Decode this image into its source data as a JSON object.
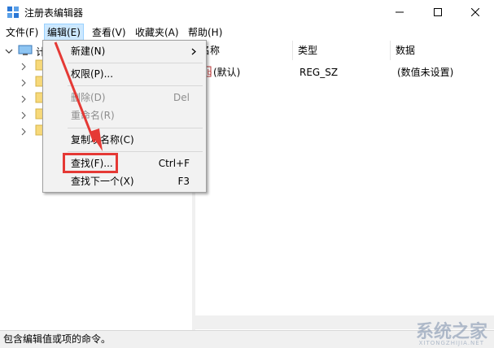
{
  "window": {
    "title": "注册表编辑器",
    "controls": {
      "minimize": "—",
      "maximize": "☐",
      "close": "✕"
    }
  },
  "menubar": {
    "items": [
      {
        "label": "文件(F)"
      },
      {
        "label": "编辑(E)",
        "active": true
      },
      {
        "label": "查看(V)"
      },
      {
        "label": "收藏夹(A)"
      },
      {
        "label": "帮助(H)"
      }
    ]
  },
  "tree": {
    "root_label": "计",
    "child_rows": 6
  },
  "list": {
    "columns": [
      "名称",
      "类型",
      "数据"
    ],
    "rows": [
      {
        "name": "(默认)",
        "type": "REG_SZ",
        "data": "(数值未设置)"
      }
    ]
  },
  "edit_menu": {
    "items": [
      {
        "label": "新建(N)",
        "shortcut": "",
        "submenu": true,
        "disabled": false
      },
      {
        "label": "权限(P)...",
        "shortcut": "",
        "submenu": false,
        "disabled": false
      },
      {
        "label": "删除(D)",
        "shortcut": "Del",
        "submenu": false,
        "disabled": true
      },
      {
        "label": "重命名(R)",
        "shortcut": "",
        "submenu": false,
        "disabled": true
      },
      {
        "label": "复制项名称(C)",
        "shortcut": "",
        "submenu": false,
        "disabled": false
      },
      {
        "label": "查找(F)...",
        "shortcut": "Ctrl+F",
        "submenu": false,
        "disabled": false
      },
      {
        "label": "查找下一个(X)",
        "shortcut": "F3",
        "submenu": false,
        "disabled": false
      }
    ]
  },
  "statusbar": {
    "text": "包含编辑值或项的命令。"
  },
  "watermark": {
    "text": "系统之家",
    "sub": "XITONGZHIJIA.NET"
  },
  "colors": {
    "menu_active_bg": "#cce8ff",
    "highlight_red": "#e53935",
    "arrow_red": "#e53935"
  }
}
